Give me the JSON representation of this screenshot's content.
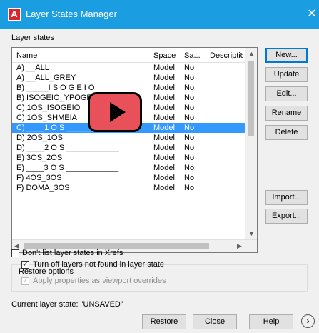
{
  "window": {
    "title": "Layer States Manager",
    "app_icon_letter": "A",
    "close_glyph": "✕"
  },
  "section_label": "Layer states",
  "columns": [
    "Name",
    "Space",
    "Sa...",
    "Description"
  ],
  "rows": [
    {
      "name": "A) __ALL",
      "space": "Model",
      "saved": "No"
    },
    {
      "name": "A) __ALL_GREY",
      "space": "Model",
      "saved": "No"
    },
    {
      "name": "B) _____I S O G E I O",
      "space": "Model",
      "saved": "No"
    },
    {
      "name": "B) ISOGEIO_YPOGEIO",
      "space": "Model",
      "saved": "No"
    },
    {
      "name": "C) 1OS_ISOGEIO",
      "space": "Model",
      "saved": "No"
    },
    {
      "name": "C) 1OS_SHMEIA",
      "space": "Model",
      "saved": "No"
    },
    {
      "name": "C) ____1 O S ____________",
      "space": "Model",
      "saved": "No"
    },
    {
      "name": "D) 2OS_1OS",
      "space": "Model",
      "saved": "No"
    },
    {
      "name": "D) ____2 O S ____________",
      "space": "Model",
      "saved": "No"
    },
    {
      "name": "E) 3OS_2OS",
      "space": "Model",
      "saved": "No"
    },
    {
      "name": "E) ____3 O S ____________",
      "space": "Model",
      "saved": "No"
    },
    {
      "name": "F) 4OS_3OS",
      "space": "Model",
      "saved": "No"
    },
    {
      "name": "F) DOMA_3OS",
      "space": "Model",
      "saved": "No"
    }
  ],
  "selected_row_index": 6,
  "buttons": {
    "new": "New...",
    "update": "Update",
    "edit": "Edit...",
    "rename": "Rename",
    "delete": "Delete",
    "import": "Import...",
    "export": "Export...",
    "restore": "Restore",
    "close": "Close",
    "help": "Help",
    "more": "›"
  },
  "xrefs_checkbox": {
    "label": "Don't list layer states in Xrefs",
    "checked": false
  },
  "restore_options": {
    "title": "Restore options",
    "turn_off": {
      "label": "Turn off layers not found in layer state",
      "checked": true
    },
    "apply_overrides": {
      "label": "Apply properties as viewport overrides",
      "checked": true,
      "disabled": true
    }
  },
  "current_state": "Current layer state: \"UNSAVED\"",
  "scroll": {
    "up": "▲",
    "down": "▼",
    "left": "◀",
    "right": "▶"
  },
  "colors": {
    "title_bar": "#1b9de2",
    "selection": "#3399ff",
    "play_overlay": "#e9515a"
  }
}
